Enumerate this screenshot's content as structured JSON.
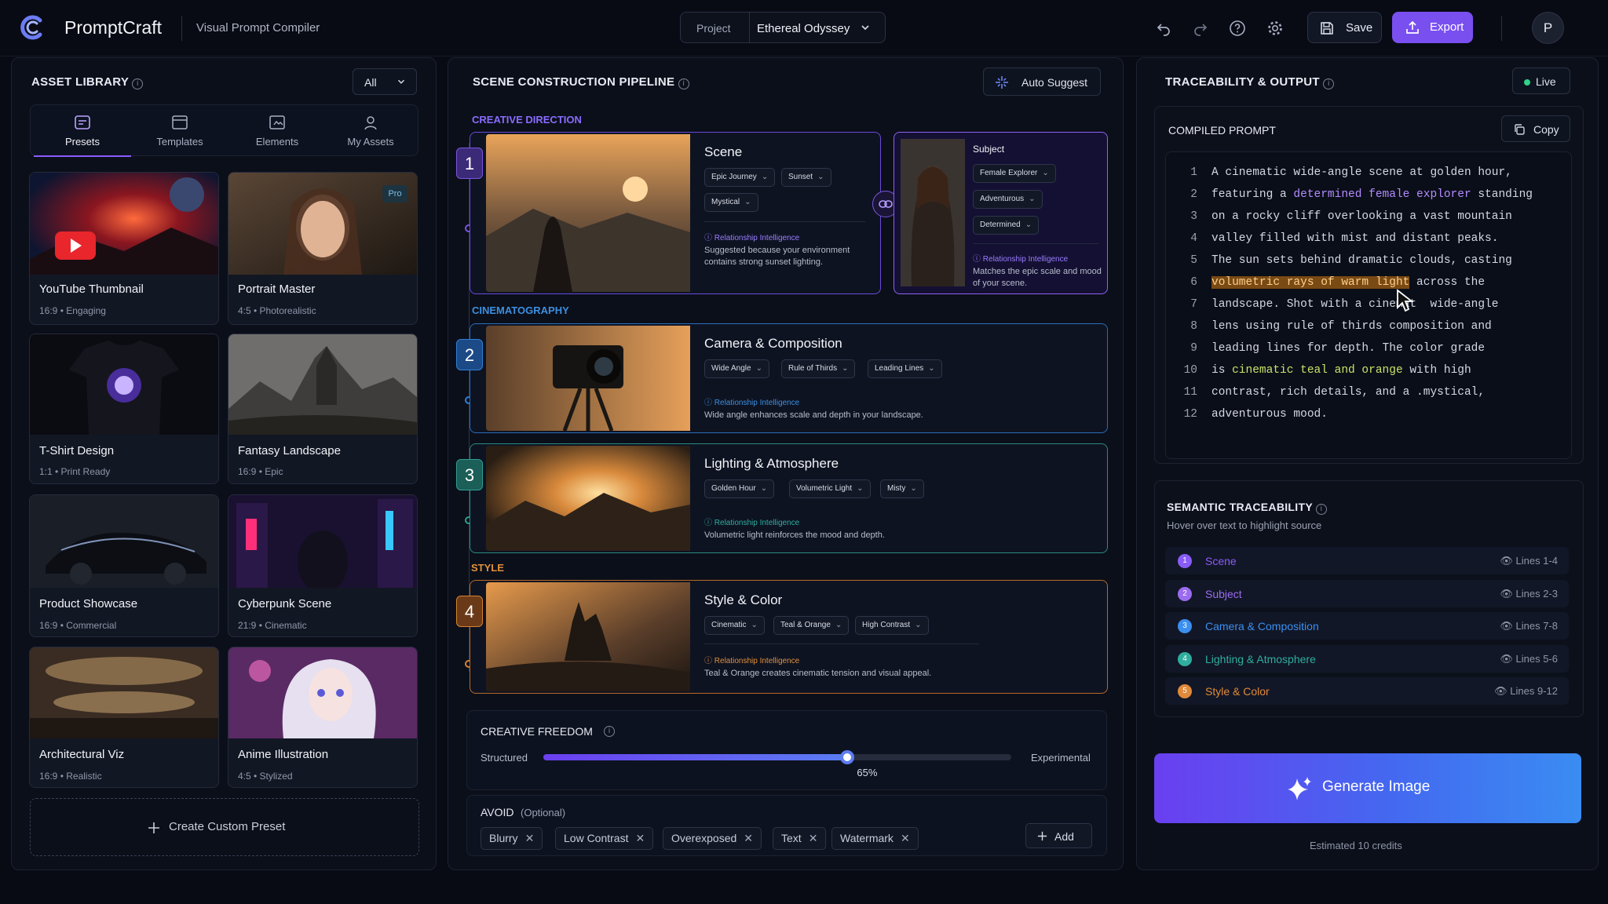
{
  "header": {
    "brand": "PromptCraft",
    "subtitle": "Visual Prompt Compiler",
    "project_label": "Project",
    "project_value": "Ethereal Odyssey",
    "save_label": "Save",
    "export_label": "Export",
    "avatar_initial": "P"
  },
  "asset_library": {
    "title": "ASSET LIBRARY",
    "filter_value": "All",
    "tabs": [
      {
        "label": "Presets",
        "icon": "presets-icon"
      },
      {
        "label": "Templates",
        "icon": "templates-icon"
      },
      {
        "label": "Elements",
        "icon": "elements-icon"
      },
      {
        "label": "My Assets",
        "icon": "my-assets-icon"
      }
    ],
    "cards": [
      {
        "title": "YouTube Thumbnail",
        "meta": "16:9 • Engaging"
      },
      {
        "title": "Portrait Master",
        "meta": "4:5 • Photorealistic",
        "badge": "Pro"
      },
      {
        "title": "T-Shirt Design",
        "meta": "1:1 • Print Ready"
      },
      {
        "title": "Fantasy Landscape",
        "meta": "16:9 • Epic"
      },
      {
        "title": "Product Showcase",
        "meta": "16:9 • Commercial"
      },
      {
        "title": "Cyberpunk Scene",
        "meta": "21:9 • Cinematic"
      },
      {
        "title": "Architectural Viz",
        "meta": "16:9 • Realistic"
      },
      {
        "title": "Anime Illustration",
        "meta": "4:5 • Stylized"
      }
    ],
    "create_label": "Create Custom Preset"
  },
  "pipeline": {
    "title": "SCENE CONSTRUCTION PIPELINE",
    "auto_suggest": "Auto Suggest",
    "sections": {
      "creative_direction": "CREATIVE DIRECTION",
      "cinematography": "CINEMATOGRAPHY",
      "style": "STYLE"
    },
    "relationship_label": "Relationship Intelligence",
    "steps": [
      {
        "num": "1",
        "title": "Scene",
        "chips": [
          "Epic Journey",
          "Sunset",
          "Mystical"
        ],
        "desc": "Suggested because your environment contains strong sunset lighting."
      },
      {
        "num": "2",
        "title": "Camera & Composition",
        "chips": [
          "Wide Angle",
          "Rule of Thirds",
          "Leading Lines"
        ],
        "desc": "Wide angle enhances scale and depth in your landscape."
      },
      {
        "num": "3",
        "title": "Lighting & Atmosphere",
        "chips": [
          "Golden Hour",
          "Volumetric Light",
          "Misty"
        ],
        "desc": "Volumetric light reinforces the mood and depth."
      },
      {
        "num": "4",
        "title": "Style & Color",
        "chips": [
          "Cinematic",
          "Teal & Orange",
          "High Contrast"
        ],
        "desc": "Teal & Orange creates cinematic tension and visual appeal."
      }
    ],
    "subject": {
      "title": "Subject",
      "chips": [
        "Female Explorer",
        "Adventurous",
        "Determined"
      ],
      "desc": "Matches the epic scale and mood of your scene."
    },
    "creative_freedom": {
      "title": "CREATIVE FREEDOM",
      "left": "Structured",
      "right": "Experimental",
      "value_label": "65%",
      "value": 0.65
    },
    "avoid": {
      "title": "AVOID",
      "optional": "(Optional)",
      "tags": [
        "Blurry",
        "Low Contrast",
        "Overexposed",
        "Text",
        "Watermark"
      ],
      "add_label": "Add"
    }
  },
  "output": {
    "title": "TRACEABILITY & OUTPUT",
    "live_label": "Live",
    "compiled_title": "COMPILED PROMPT",
    "copy_label": "Copy",
    "lines": [
      {
        "n": "1",
        "parts": [
          {
            "t": "A cinematic wide-angle scene at golden hour,",
            "c": ""
          }
        ]
      },
      {
        "n": "2",
        "parts": [
          {
            "t": "featuring a ",
            "c": ""
          },
          {
            "t": "determined female explorer",
            "c": "hl-p"
          },
          {
            "t": " standing",
            "c": ""
          }
        ]
      },
      {
        "n": "3",
        "parts": [
          {
            "t": "on a rocky cliff overlooking a vast mountain",
            "c": ""
          }
        ]
      },
      {
        "n": "4",
        "parts": [
          {
            "t": "valley filled with mist and distant peaks.",
            "c": ""
          }
        ]
      },
      {
        "n": "5",
        "parts": [
          {
            "t": "The sun sets behind dramatic clouds, casting",
            "c": ""
          }
        ]
      },
      {
        "n": "6",
        "parts": [
          {
            "t": "volumetric rays of warm light",
            "c": "hl-o"
          },
          {
            "t": " across the",
            "c": ""
          }
        ]
      },
      {
        "n": "7",
        "parts": [
          {
            "t": "landscape. Shot with a cinemat  wide-angle",
            "c": ""
          }
        ]
      },
      {
        "n": "8",
        "parts": [
          {
            "t": "lens using rule of thirds composition and",
            "c": ""
          }
        ]
      },
      {
        "n": "9",
        "parts": [
          {
            "t": "leading lines for depth. The color grade",
            "c": ""
          }
        ]
      },
      {
        "n": "10",
        "parts": [
          {
            "t": "is ",
            "c": ""
          },
          {
            "t": "cinematic teal and orange",
            "c": "hl-g"
          },
          {
            "t": " with high",
            "c": ""
          }
        ]
      },
      {
        "n": "11",
        "parts": [
          {
            "t": "contrast, rich details, and a .mystical,",
            "c": ""
          }
        ]
      },
      {
        "n": "12",
        "parts": [
          {
            "t": "adventurous mood.",
            "c": ""
          }
        ]
      }
    ],
    "semantic_title": "SEMANTIC TRACEABILITY",
    "semantic_sub": "Hover over text to highlight source",
    "trace": [
      {
        "num": "1",
        "name": "Scene",
        "lines": "Lines 1-4",
        "color": "#8a5cf6"
      },
      {
        "num": "2",
        "name": "Subject",
        "lines": "Lines 2-3",
        "color": "#9b6cf0"
      },
      {
        "num": "3",
        "name": "Camera & Composition",
        "lines": "Lines 7-8",
        "color": "#3b8ff0"
      },
      {
        "num": "4",
        "name": "Lighting & Atmosphere",
        "lines": "Lines 5-6",
        "color": "#2fae9e"
      },
      {
        "num": "5",
        "name": "Style & Color",
        "lines": "Lines 9-12",
        "color": "#e08a3a"
      }
    ],
    "generate_label": "Generate Image",
    "credits": "Estimated 10 credits"
  },
  "colors": {
    "accent": "#7a4ff0",
    "step1": "#7b55e0",
    "step2": "#2f80d8",
    "step3": "#2e9f90",
    "step4": "#d9822f"
  }
}
